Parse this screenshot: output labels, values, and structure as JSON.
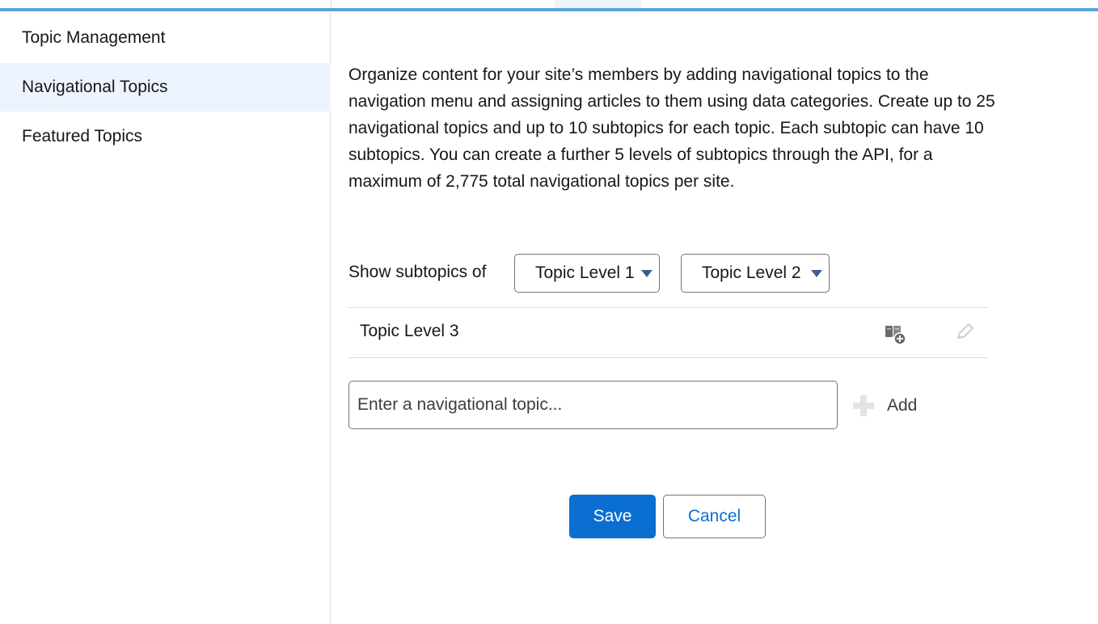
{
  "sidebar": {
    "items": [
      {
        "label": "Topic Management"
      },
      {
        "label": "Navigational Topics"
      },
      {
        "label": "Featured Topics"
      }
    ]
  },
  "main": {
    "description": "Organize content for your site’s members by adding navigational topics to the navigation menu and assigning articles to them using data categories. Create up to 25 navigational topics and up to 10 subtopics for each topic. Each subtopic can have 10 subtopics. You can create a further 5 levels of subtopics through the API, for a maximum of 2,775 total navigational topics per site.",
    "filter_label": "Show subtopics of",
    "select1_value": "Topic Level 1",
    "select2_value": "Topic Level 2",
    "topic_row": {
      "name": "Topic Level 3"
    },
    "input_placeholder": "Enter a navigational topic...",
    "add_label": "Add",
    "save_label": "Save",
    "cancel_label": "Cancel"
  },
  "colors": {
    "accent": "#0a6fd1",
    "topbar": "#5aa3d8",
    "active_item_bg": "#eef4fd"
  },
  "icons": {
    "assign": "assign-articles-icon",
    "edit": "pencil-icon",
    "add": "plus-icon",
    "dropdown": "caret-down-icon"
  }
}
